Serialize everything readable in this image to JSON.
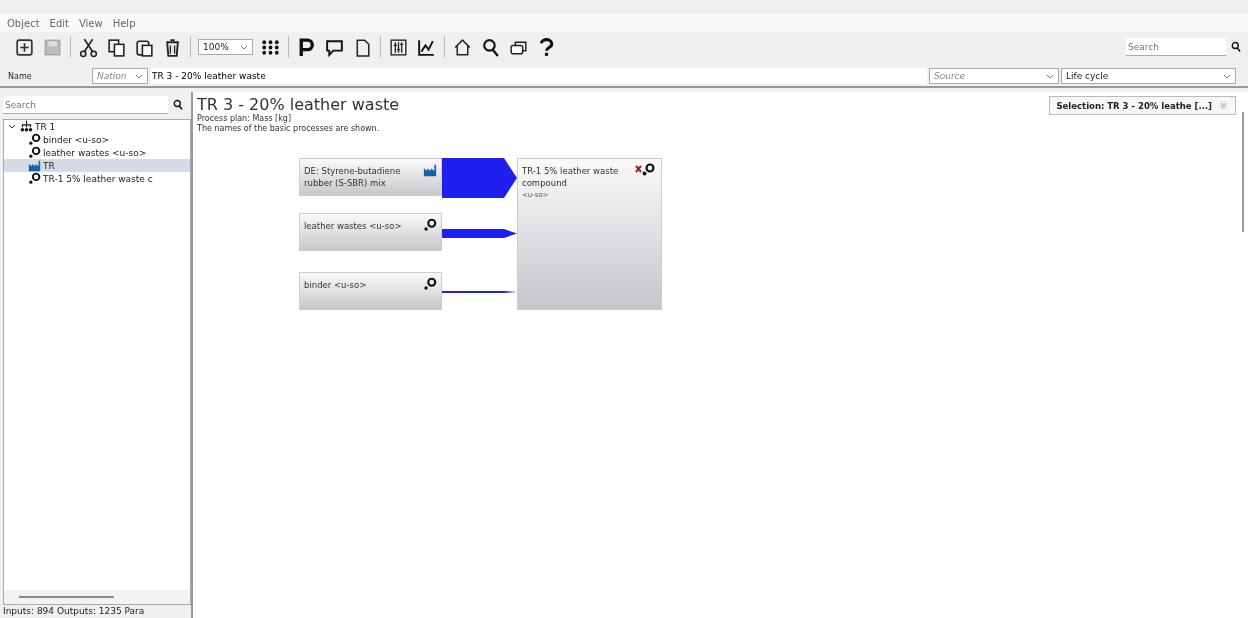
{
  "menu": [
    "Object",
    "Edit",
    "View",
    "Help"
  ],
  "toolbar": {
    "zoom": "100%",
    "search_placeholder": "Search"
  },
  "name_row": {
    "label": "Name",
    "nation_placeholder": "Nation",
    "name_value": "TR 3 - 20% leather waste",
    "source_placeholder": "Source",
    "lifecycle_value": "Life cycle"
  },
  "sidebar": {
    "search_placeholder": "Search",
    "tree": [
      {
        "label": "TR 1",
        "kind": "plan",
        "expanded": true,
        "selected": false,
        "children": [
          {
            "label": "binder <u-so>",
            "kind": "process",
            "selected": false
          },
          {
            "label": "leather wastes <u-so>",
            "kind": "process",
            "selected": false
          },
          {
            "label": "TR",
            "kind": "plan",
            "selected": true
          },
          {
            "label": "TR-1 5% leather waste c",
            "kind": "process",
            "selected": false
          }
        ]
      }
    ],
    "status": "Inputs: 894 Outputs: 1235 Para"
  },
  "canvas": {
    "title": "TR 3 - 20% leather waste",
    "subtitle": "Process plan: Mass [kg]",
    "note": "The names of the basic processes are shown.",
    "selection": "Selection: TR 3 - 20% leathe [...]",
    "nodes": [
      {
        "label": "DE: Styrene-butadiene rubber (S-SBR) mix",
        "kind": "plan"
      },
      {
        "label": "leather wastes <u-so>",
        "kind": "process"
      },
      {
        "label": "binder <u-so>",
        "kind": "process"
      }
    ],
    "target": {
      "label": "TR-1 5% leather waste compound",
      "tag": "<u-so>"
    }
  }
}
